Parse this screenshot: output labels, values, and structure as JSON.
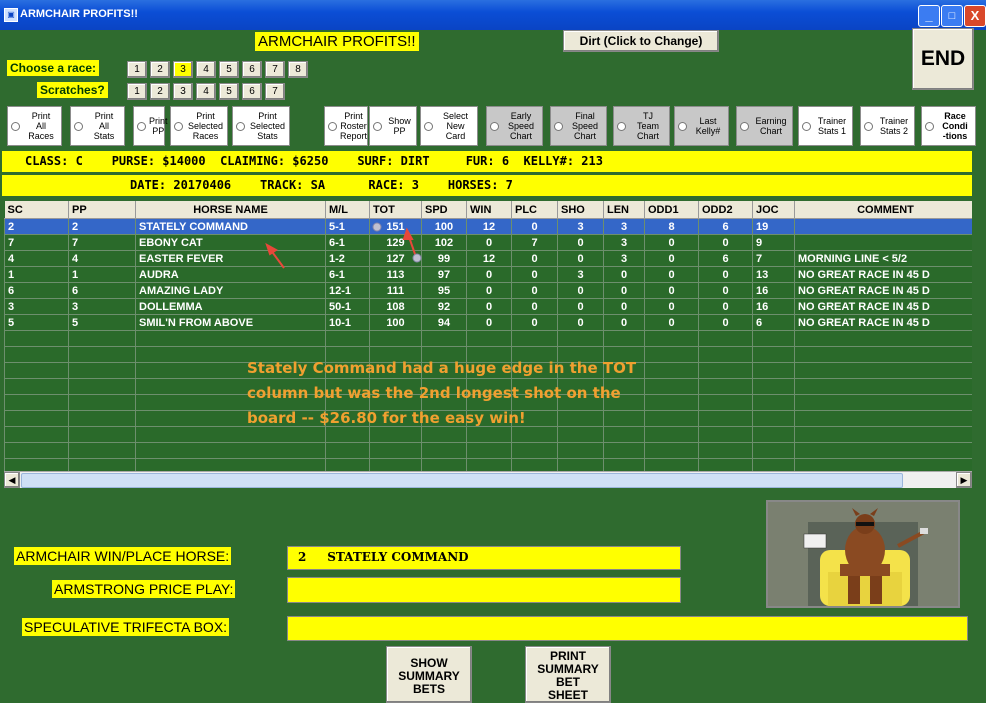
{
  "window": {
    "title": "ARMCHAIR PROFITS!!",
    "icon": "app-icon",
    "controls": [
      "_",
      "□",
      "X"
    ]
  },
  "header": {
    "title": "ARMCHAIR PROFITS!!",
    "dirt_button": "Dirt (Click to Change)",
    "end_button": "END"
  },
  "race_select": {
    "label": "Choose  a race:",
    "numbers": [
      "1",
      "2",
      "3",
      "4",
      "5",
      "6",
      "7",
      "8"
    ],
    "selected": "3"
  },
  "scratches": {
    "label": "Scratches?",
    "numbers": [
      "1",
      "2",
      "3",
      "4",
      "5",
      "6",
      "7"
    ]
  },
  "options": [
    {
      "l1": "Print",
      "l2": "All",
      "l3": "Races"
    },
    {
      "l1": "Print",
      "l2": "All",
      "l3": "Stats"
    },
    {
      "l1": "Print",
      "l2": "PP",
      "l3": ""
    },
    {
      "l1": "Print",
      "l2": "Selected",
      "l3": "Races"
    },
    {
      "l1": "Print",
      "l2": "Selected",
      "l3": "Stats"
    },
    {
      "l1": "Print",
      "l2": "Roster",
      "l3": "Report"
    },
    {
      "l1": "Show",
      "l2": "PP",
      "l3": ""
    },
    {
      "l1": "Select",
      "l2": "New",
      "l3": "Card"
    },
    {
      "l1": "Early",
      "l2": "Speed",
      "l3": "Chart"
    },
    {
      "l1": "Final",
      "l2": "Speed",
      "l3": "Chart"
    },
    {
      "l1": "TJ",
      "l2": "Team",
      "l3": "Chart"
    },
    {
      "l1": "Last",
      "l2": "Kelly#",
      "l3": ""
    },
    {
      "l1": "Earning",
      "l2": "Chart",
      "l3": ""
    },
    {
      "l1": "Trainer",
      "l2": "Stats 1",
      "l3": ""
    },
    {
      "l1": "Trainer",
      "l2": "Stats 2",
      "l3": ""
    },
    {
      "l1": "Race",
      "l2": "Condi",
      "l3": "-tions"
    }
  ],
  "info": {
    "line1": "CLASS: C    PURSE: $14000  CLAIMING: $6250    SURF: DIRT     FUR: 6  KELLY#: 213",
    "line2": "DATE: 20170406    TRACK: SA      RACE: 3    HORSES: 7"
  },
  "table": {
    "headers": [
      "SC",
      "PP",
      "HORSE NAME",
      "M/L",
      "TOT",
      "SPD",
      "WIN",
      "PLC",
      "SHO",
      "LEN",
      "ODD1",
      "ODD2",
      "JOC",
      "COMMENT"
    ],
    "rows": [
      [
        "2",
        "2",
        "STATELY COMMAND",
        "5-1",
        "151",
        "100",
        "12",
        "0",
        "3",
        "3",
        "8",
        "6",
        "19",
        ""
      ],
      [
        "7",
        "7",
        "EBONY CAT",
        "6-1",
        "129",
        "102",
        "0",
        "7",
        "0",
        "3",
        "0",
        "0",
        "9",
        ""
      ],
      [
        "4",
        "4",
        "EASTER FEVER",
        "1-2",
        "127",
        "99",
        "12",
        "0",
        "0",
        "3",
        "0",
        "6",
        "7",
        "MORNING LINE < 5/2"
      ],
      [
        "1",
        "1",
        "AUDRA",
        "6-1",
        "113",
        "97",
        "0",
        "0",
        "3",
        "0",
        "0",
        "0",
        "13",
        "NO GREAT RACE IN 45 D"
      ],
      [
        "6",
        "6",
        "AMAZING LADY",
        "12-1",
        "111",
        "95",
        "0",
        "0",
        "0",
        "0",
        "0",
        "0",
        "16",
        "NO GREAT RACE IN 45 D"
      ],
      [
        "3",
        "3",
        "DOLLEMMA",
        "50-1",
        "108",
        "92",
        "0",
        "0",
        "0",
        "0",
        "0",
        "0",
        "16",
        "NO GREAT RACE IN 45 D"
      ],
      [
        "5",
        "5",
        "SMIL'N FROM ABOVE",
        "10-1",
        "100",
        "94",
        "0",
        "0",
        "0",
        "0",
        "0",
        "0",
        "6",
        "NO GREAT RACE IN 45 D"
      ]
    ],
    "empty_rows": 10
  },
  "annotation": {
    "line1": "Stately Command had a huge edge in the TOT",
    "line2": "column but was the 2nd longest shot on the",
    "line3": "board -- $26.80 for the easy win!"
  },
  "fields": {
    "win_place_label": "ARMCHAIR WIN/PLACE HORSE:",
    "win_place_value": "2     STATELY COMMAND",
    "armstrong_label": "ARMSTRONG PRICE PLAY:",
    "armstrong_value": "",
    "trifecta_label": "SPECULATIVE TRIFECTA BOX:",
    "trifecta_value": ""
  },
  "buttons": {
    "show_summary": [
      "SHOW",
      "SUMMARY",
      "BETS"
    ],
    "print_summary": [
      "PRINT",
      "SUMMARY",
      "BET",
      "SHEET"
    ]
  },
  "colors": {
    "bg": "#2f6b2f",
    "accent": "#ffff00",
    "selected_row": "#3467c8",
    "annotation": "#f0a030"
  }
}
